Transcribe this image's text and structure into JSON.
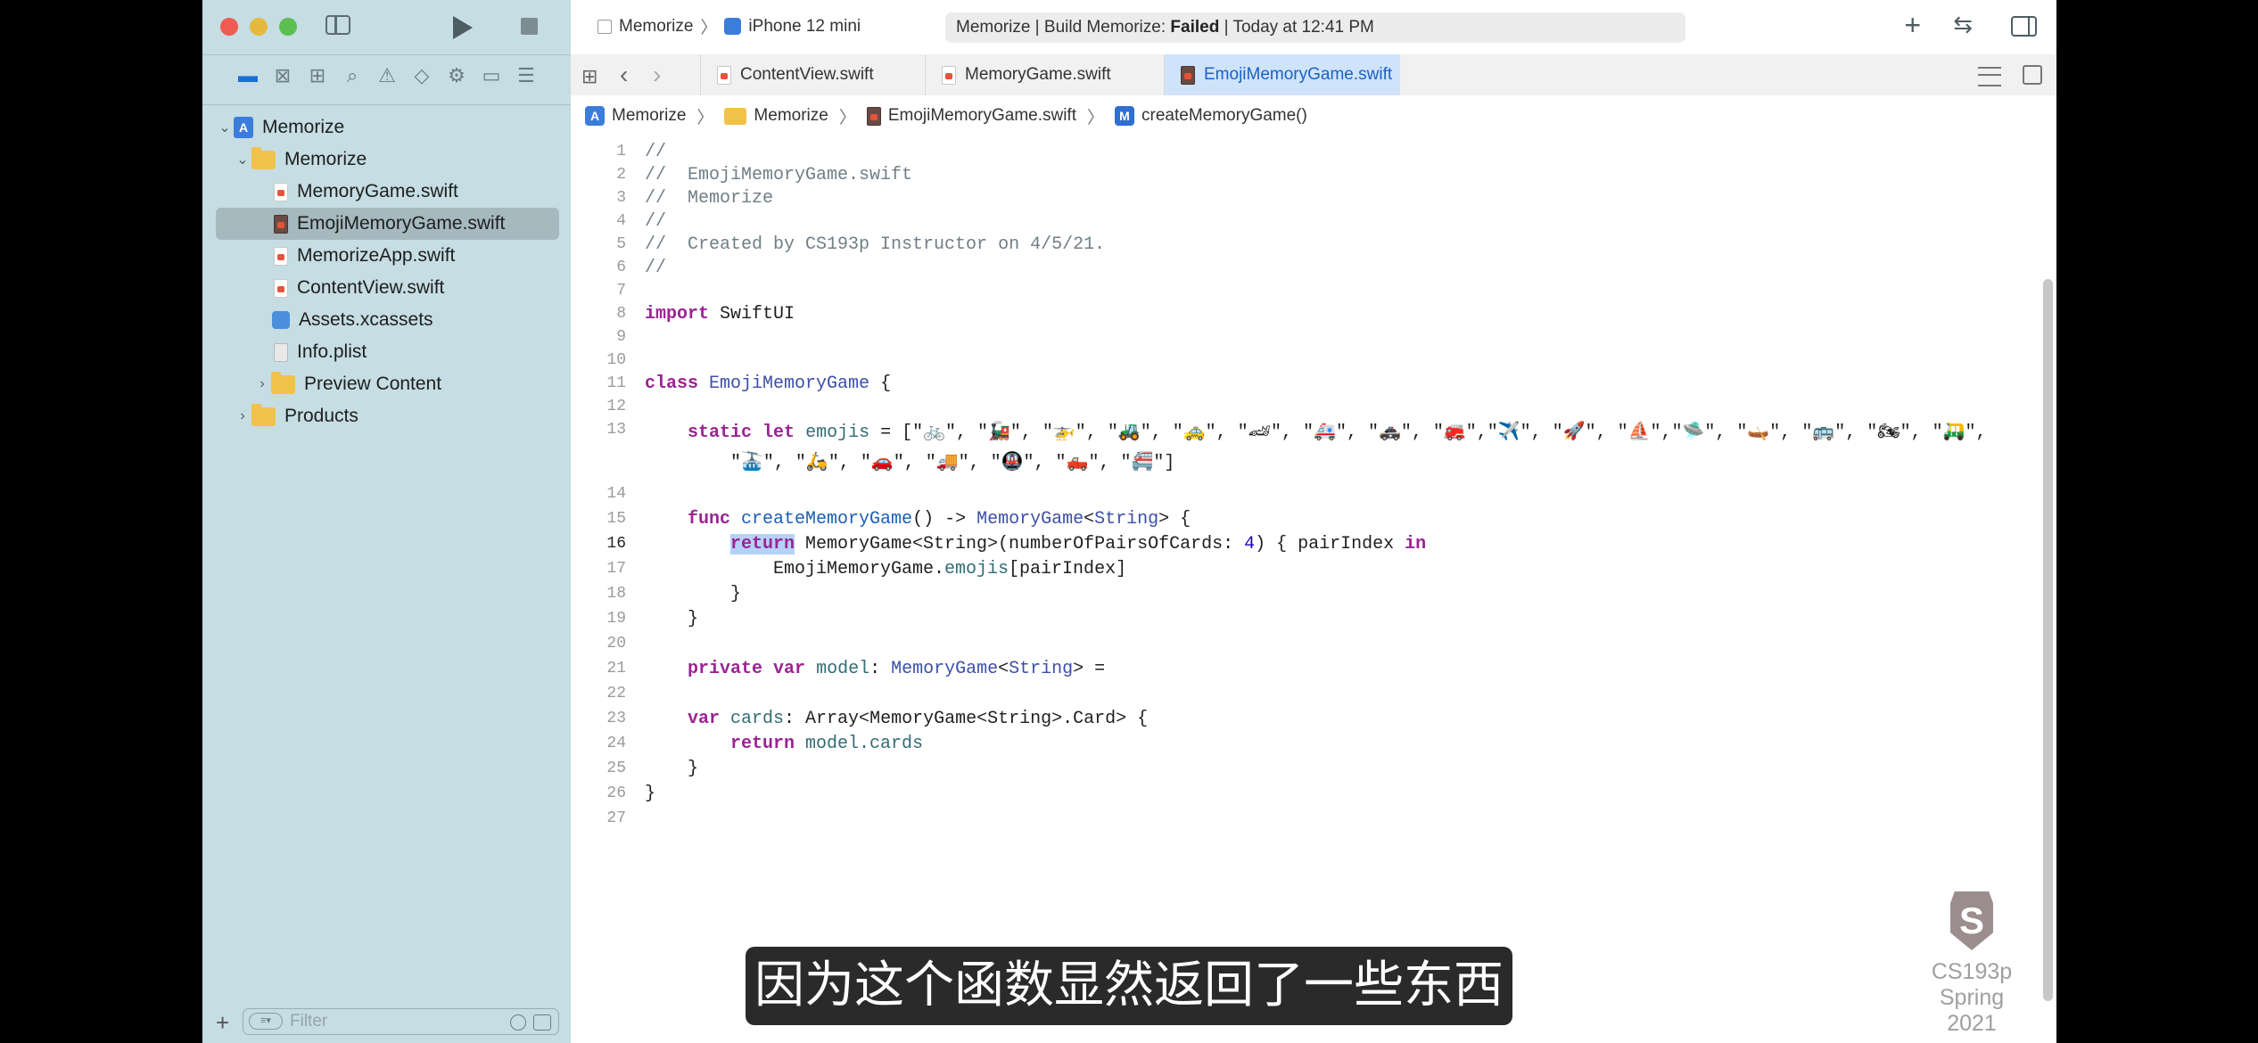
{
  "toolbar": {
    "project": "Memorize",
    "device": "iPhone 12 mini",
    "status_prefix": "Memorize | Build Memorize: ",
    "status_result": "Failed",
    "status_suffix": " | Today at 12:41 PM"
  },
  "tabs": [
    {
      "label": "ContentView.swift"
    },
    {
      "label": "MemoryGame.swift"
    },
    {
      "label": "EmojiMemoryGame.swift"
    }
  ],
  "jumpbar": {
    "project": "Memorize",
    "folder": "Memorize",
    "file": "EmojiMemoryGame.swift",
    "method_badge": "M",
    "method": "createMemoryGame()"
  },
  "navigator": {
    "items": [
      {
        "label": "Memorize"
      },
      {
        "label": "Memorize"
      },
      {
        "label": "MemoryGame.swift"
      },
      {
        "label": "EmojiMemoryGame.swift"
      },
      {
        "label": "MemorizeApp.swift"
      },
      {
        "label": "ContentView.swift"
      },
      {
        "label": "Assets.xcassets"
      },
      {
        "label": "Info.plist"
      },
      {
        "label": "Preview Content"
      },
      {
        "label": "Products"
      }
    ],
    "filter_placeholder": "Filter"
  },
  "code": {
    "line_numbers": [
      "1",
      "2",
      "3",
      "4",
      "5",
      "6",
      "7",
      "8",
      "9",
      "10",
      "11",
      "12",
      "13",
      "14",
      "15",
      "16",
      "17",
      "18",
      "19",
      "20",
      "21",
      "22",
      "23",
      "24",
      "25",
      "26",
      "27"
    ],
    "l1": "//",
    "l2": "//  EmojiMemoryGame.swift",
    "l3": "//  Memorize",
    "l4": "//",
    "l5": "//  Created by CS193p Instructor on 4/5/21.",
    "l6": "//",
    "kw_import": "import",
    "mod_swiftui": "SwiftUI",
    "kw_class": "class",
    "class_name": "EmojiMemoryGame",
    "brace_open": "{",
    "brace_close": "}",
    "kw_static": "static",
    "kw_let": "let",
    "id_emojis": "emojis",
    "emoji_line1": " = [\"🚲\", \"🚂\", \"🚁\", \"🚜\", \"🚕\", \"🏎\", \"🚑\", \"🚓\", \"🚒\",\"✈️\", \"🚀\", \"⛵️\",\"🛸\", \"🛶\", \"🚌\", \"🏍\", \"🛺\",",
    "emoji_line2": "\"🚠\", \"🛵\", \"🚗\", \"🚚\", \"🚇\", \"🛻\", \"🚝\"]",
    "kw_func": "func",
    "fn_create": "createMemoryGame",
    "l15_mid": "() -> ",
    "ty_memorygame": "MemoryGame",
    "lt": "<",
    "ty_string": "String",
    "gt": ">",
    "l15_end": " {",
    "kw_return": "return",
    "l16_a": " MemoryGame<String>(numberOfPairsOfCards: ",
    "num_4": "4",
    "l16_b": ") { pairIndex ",
    "kw_in": "in",
    "l17_a": "EmojiMemoryGame.",
    "l17_b": "emojis",
    "l17_c": "[pairIndex]",
    "kw_private": "private",
    "kw_var": "var",
    "id_model": "model",
    "l21_end": " =",
    "id_cards": "cards",
    "l23_mid": ": Array<MemoryGame<String>.Card> {",
    "l24_b": "model.cards",
    "l21_colon": ": "
  },
  "subtitle": "因为这个函数显然返回了一些东西",
  "watermark": {
    "line1": "CS193p",
    "line2": "Spring 2021",
    "logo": "S"
  }
}
